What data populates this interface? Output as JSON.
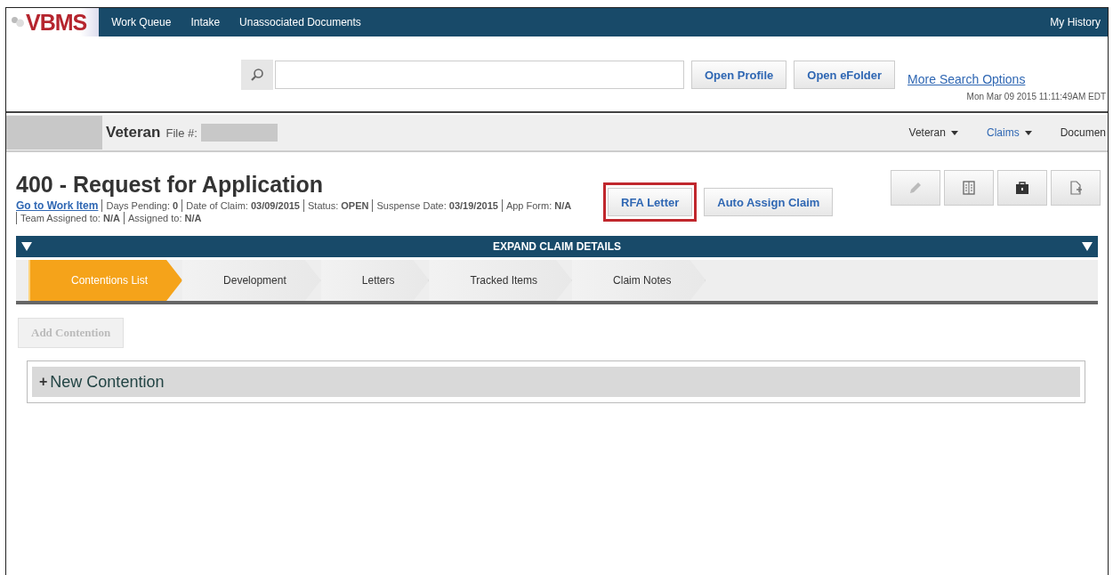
{
  "nav": {
    "logo": "VBMS",
    "items": [
      "Work Queue",
      "Intake",
      "Unassociated Documents"
    ],
    "right": "My History"
  },
  "search": {
    "buttons": [
      "Open Profile",
      "Open eFolder"
    ],
    "link": "More Search Options",
    "timestamp": "Mon Mar 09 2015 11:11:49AM EDT"
  },
  "veteran_bar": {
    "title": "Veteran",
    "file_label": "File #:",
    "menus": [
      {
        "label": "Veteran",
        "selected": false,
        "has_menu": true
      },
      {
        "label": "Claims",
        "selected": true,
        "has_menu": true
      },
      {
        "label": "Documen",
        "selected": false,
        "has_menu": false
      }
    ]
  },
  "claim": {
    "title": "400 - Request for Application",
    "link": "Go to Work Item",
    "fields": [
      "Days Pending: **0**",
      "Date of Claim: **03/09/2015**",
      "Status: **OPEN**",
      "Suspense Date: **03/19/2015**",
      "App Form: **N/A**",
      "Team Assigned to: **N/A**",
      "Assigned to: **N/A**"
    ],
    "buttons": [
      {
        "label": "RFA Letter",
        "highlighted": true
      },
      {
        "label": "Auto Assign Claim",
        "highlighted": false
      }
    ],
    "tool_buttons": [
      {
        "kind": "edit",
        "disabled": true
      },
      {
        "kind": "columns",
        "disabled": false
      },
      {
        "kind": "case",
        "disabled": false
      },
      {
        "kind": "document",
        "disabled": false
      }
    ]
  },
  "expand_bar": {
    "label": "EXPAND CLAIM DETAILS"
  },
  "tabs": [
    {
      "label": "Contentions List",
      "selected": true
    },
    {
      "label": "Development",
      "selected": false
    },
    {
      "label": "Letters",
      "selected": false
    },
    {
      "label": "Tracked Items",
      "selected": false
    },
    {
      "label": "Claim Notes",
      "selected": false
    }
  ],
  "add_button": {
    "label": "Add Contention",
    "disabled": true
  },
  "contention_panel": {
    "plus": "+",
    "label": "New Contention"
  }
}
